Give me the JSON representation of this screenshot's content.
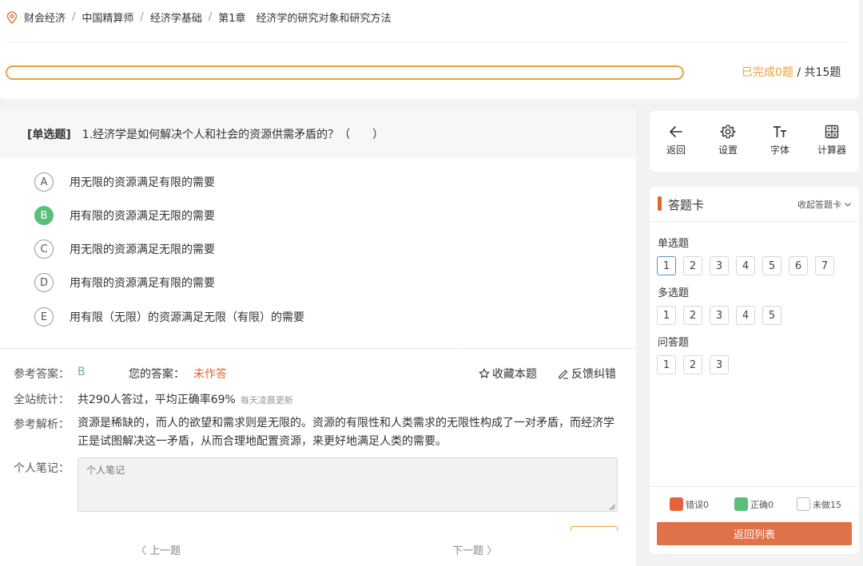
{
  "breadcrumb": {
    "items": [
      "财会经济",
      "中国精算师",
      "经济学基础",
      "第1章　经济学的研究对象和研究方法"
    ],
    "separator": "/"
  },
  "progress": {
    "completed_label": "已完成0题",
    "total_label": "/ 共15题",
    "fraction": 0
  },
  "question": {
    "type_label": "[单选题]",
    "text": "1.经济学是如何解决个人和社会的资源供需矛盾的？（　　）",
    "options": [
      {
        "letter": "A",
        "text": "用无限的资源满足有限的需要",
        "selected": false
      },
      {
        "letter": "B",
        "text": "用有限的资源满足无限的需要",
        "selected": true
      },
      {
        "letter": "C",
        "text": "用无限的资源满足无限的需要",
        "selected": false
      },
      {
        "letter": "D",
        "text": "用有限的资源满足有限的需要",
        "selected": false
      },
      {
        "letter": "E",
        "text": "用有限（无限）的资源满足无限（有限）的需要",
        "selected": false
      }
    ]
  },
  "answer": {
    "ref_label": "参考答案：",
    "ref_value": "B",
    "your_label": "您的答案：",
    "your_value": "未作答",
    "favorite_label": "收藏本题",
    "feedback_label": "反馈纠错"
  },
  "stats": {
    "label": "全站统计：",
    "value": "共290人答过，平均正确率69%",
    "note": "每天凌晨更新"
  },
  "analysis": {
    "label": "参考解析：",
    "text": "资源是稀缺的，而人的欲望和需求则是无限的。资源的有限性和人类需求的无限性构成了一对矛盾，而经济学正是试图解决这一矛盾，从而合理地配置资源，来更好地满足人类的需要。"
  },
  "notes": {
    "label": "个人笔记：",
    "placeholder": "个人笔记"
  },
  "nav": {
    "prev_label": "上一题",
    "next_label": "下一题"
  },
  "tools": {
    "back": "返回",
    "settings": "设置",
    "font": "字体",
    "calculator": "计算器"
  },
  "card": {
    "title": "答题卡",
    "collapse_label": "收起答题卡",
    "sections": [
      {
        "title": "单选题",
        "numbers": [
          "1",
          "2",
          "3",
          "4",
          "5",
          "6",
          "7"
        ]
      },
      {
        "title": "多选题",
        "numbers": [
          "1",
          "2",
          "3",
          "4",
          "5"
        ]
      },
      {
        "title": "问答题",
        "numbers": [
          "1",
          "2",
          "3"
        ]
      }
    ],
    "legend": {
      "wrong": "错误0",
      "right": "正确0",
      "undone": "未做15"
    },
    "return_label": "返回列表"
  },
  "colors": {
    "accent_orange": "#e8a13a",
    "correct_green": "#5bbf7a",
    "wrong_red": "#e0672e",
    "return_button": "#e0724a",
    "current_blue": "#5b8fd8"
  }
}
